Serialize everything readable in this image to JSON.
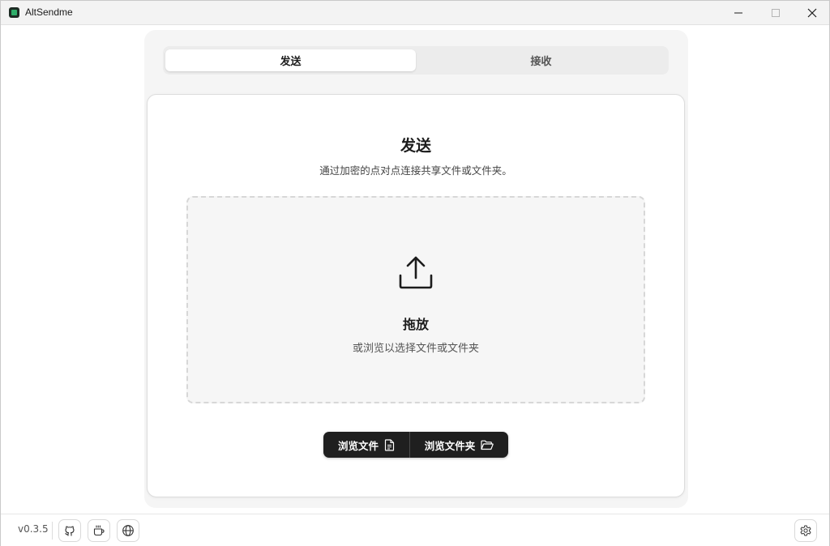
{
  "window": {
    "title": "AltSendme",
    "controls": [
      "minimize-icon",
      "maximize-icon",
      "close-icon"
    ]
  },
  "tabs": [
    {
      "label": "发送",
      "active": true
    },
    {
      "label": "接收",
      "active": false
    }
  ],
  "send_panel": {
    "title": "发送",
    "subtitle": "通过加密的点对点连接共享文件或文件夹。",
    "dropzone": {
      "icon": "upload-icon",
      "title": "拖放",
      "subtitle": "或浏览以选择文件或文件夹"
    },
    "buttons": {
      "browse_files": {
        "label": "浏览文件",
        "icon": "file-icon"
      },
      "browse_folder": {
        "label": "浏览文件夹",
        "icon": "folder-open-icon"
      }
    }
  },
  "footer": {
    "version": "v0.3.5",
    "links": [
      "github-icon",
      "coffee-icon",
      "globe-icon"
    ],
    "settings_icon": "gear-icon"
  },
  "colors": {
    "accent_dark": "#1f1f1f",
    "app_icon_green": "#2fae6a"
  }
}
